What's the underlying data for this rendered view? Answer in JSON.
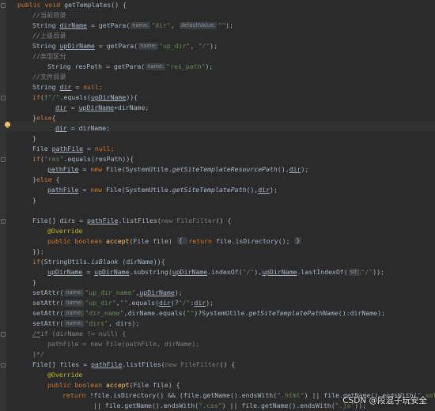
{
  "watermark": "CSDN @段混子玩安全",
  "icons": {
    "bulb": "lightbulb-icon",
    "fold": "fold-marker-icon"
  },
  "colors": {
    "background": "#2b2b2b",
    "keyword": "#cc7832",
    "string": "#6a8759",
    "comment": "#808080",
    "field": "#9876aa"
  },
  "code": {
    "l01_kw": "public void ",
    "l01_rest": "getTemplates() {",
    "l02": "//当前目录",
    "l03_a": "String ",
    "l03_b": "dirName",
    "l03_c": " = getPara(",
    "l03_h1": "name:",
    "l03_s1": "\"dir\"",
    "l03_d": ", ",
    "l03_h2": "defaultValue:",
    "l03_s2": "\"\"",
    "l03_e": ");",
    "l04": "//上级目录",
    "l05_a": "String ",
    "l05_b": "upDirName",
    "l05_c": " = getPara(",
    "l05_h1": "name:",
    "l05_s1": "\"up_dir\"",
    "l05_d": ", ",
    "l05_s2": "\"/\"",
    "l05_e": ");",
    "l06": "//类型区分",
    "l07_a": "String resPath = getPara(",
    "l07_h1": "name:",
    "l07_s1": "\"res_path\"",
    "l07_e": ");",
    "l08": "//文件目录",
    "l09_a": "String ",
    "l09_b": "dir",
    "l09_c": " = ",
    "l09_kw": "null",
    "l09_e": ";",
    "l10_kw": "if",
    "l10_a": "(!",
    "l10_s": "\"/\"",
    "l10_b": ".equals(",
    "l10_c": "upDirName",
    "l10_e": ")){",
    "l11_a": "dir",
    "l11_b": " = ",
    "l11_c": "upDirName",
    "l11_d": "+dirName;",
    "l12_a": "}",
    "l12_kw": "else",
    "l12_b": "{",
    "l13_a": "dir",
    "l13_b": " = dirName;",
    "l14": "}",
    "l15_a": "File ",
    "l15_b": "pathFile",
    "l15_c": " = ",
    "l15_kw": "null",
    "l15_e": ";",
    "l16_kw": "if",
    "l16_a": "(",
    "l16_s": "\"res\"",
    "l16_b": ".equals(resPath)){",
    "l17_a": "pathFile",
    "l17_b": " = ",
    "l17_kw": "new ",
    "l17_c": "File(SystemUtile.",
    "l17_d": "getSiteTemplateResourcePath",
    "l17_e": "(),",
    "l17_f": "dir",
    "l17_g": ");",
    "l18_a": "}",
    "l18_kw": "else ",
    "l18_b": "{",
    "l19_a": "pathFile",
    "l19_b": " = ",
    "l19_kw": "new ",
    "l19_c": "File(SystemUtile.",
    "l19_d": "getSiteTemplatePath",
    "l19_e": "(),",
    "l19_f": "dir",
    "l19_g": ");",
    "l20": "}",
    "l21": "",
    "l22_a": "File[] dirs = ",
    "l22_b": "pathFile",
    "l22_c": ".listFiles(",
    "l22_d": "new FileFilter",
    "l22_e": "() {",
    "l23": "@Override",
    "l24_kw": "public boolean ",
    "l24_a": "accept",
    "l24_b": "(File file) ",
    "l24_c": "{ ",
    "l24_kw2": "return ",
    "l24_d": "file.isDirectory(); ",
    "l24_e": "}",
    "l25": "});",
    "l26_kw": "if",
    "l26_a": "(StringUtils.",
    "l26_b": "isBlank",
    "l26_c": " (dirName)){",
    "l27_a": "upDirName",
    "l27_b": " = ",
    "l27_c": "upDirName",
    "l27_d": ".substring(",
    "l27_e": "upDirName",
    "l27_f": ".indexOf(",
    "l27_s1": "\"/\"",
    "l27_g": "),",
    "l27_h": "upDirName",
    "l27_i": ".lastIndexOf(",
    "l27_hint": "str:",
    "l27_s2": "\"/\"",
    "l27_j": "));",
    "l28": "}",
    "l29_a": "setAttr(",
    "l29_h": "name:",
    "l29_s": "\"up_dir_name\"",
    "l29_b": ",",
    "l29_c": "upDirName",
    "l29_d": ");",
    "l30_a": "setAttr(",
    "l30_h": "name:",
    "l30_s1": "\"up_dir\"",
    "l30_b": ",",
    "l30_s2": "\"\"",
    "l30_c": ".equals(",
    "l30_d": "dir",
    "l30_e": ")?",
    "l30_s3": "\"/\"",
    "l30_f": ":",
    "l30_g": "dir",
    "l30_i": ");",
    "l31_a": "setAttr(",
    "l31_h": "name:",
    "l31_s1": "\"dir_name\"",
    "l31_b": ",dirName.equals(",
    "l31_s2": "\"\"",
    "l31_c": ")?SystemUtile.",
    "l31_d": "getSiteTemplatePathName",
    "l31_e": "():dirName);",
    "l32_a": "setAttr(",
    "l32_h": "name:",
    "l32_s": "\"dirs\"",
    "l32_b": ", dirs);",
    "l33_a": "/*",
    "l33_b": "if (dirName != null) {",
    "l34": "pathFile = new File(pathFile, dirName);",
    "l35": "}*/",
    "l36_a": "File[] files = ",
    "l36_b": "pathFile",
    "l36_c": ".listFiles(",
    "l36_d": "new FileFilter",
    "l36_e": "() {",
    "l37": "@Override",
    "l38_kw": "public boolean ",
    "l38_a": "accept",
    "l38_b": "(File file) {",
    "l39_kw": "return ",
    "l39_a": "!file.isDirectory() && (file.getName().endsWith(",
    "l39_s1": "\".html\"",
    "l39_b": ") || file.getName().endsWith(",
    "l39_s2": "\".xml\"",
    "l40_a": "|| file.getName().endsWith(",
    "l40_s1": "\".css\"",
    "l40_b": ") || file.getName().endsWith(",
    "l40_s2": "\".js\"",
    "l40_c": "));"
  }
}
